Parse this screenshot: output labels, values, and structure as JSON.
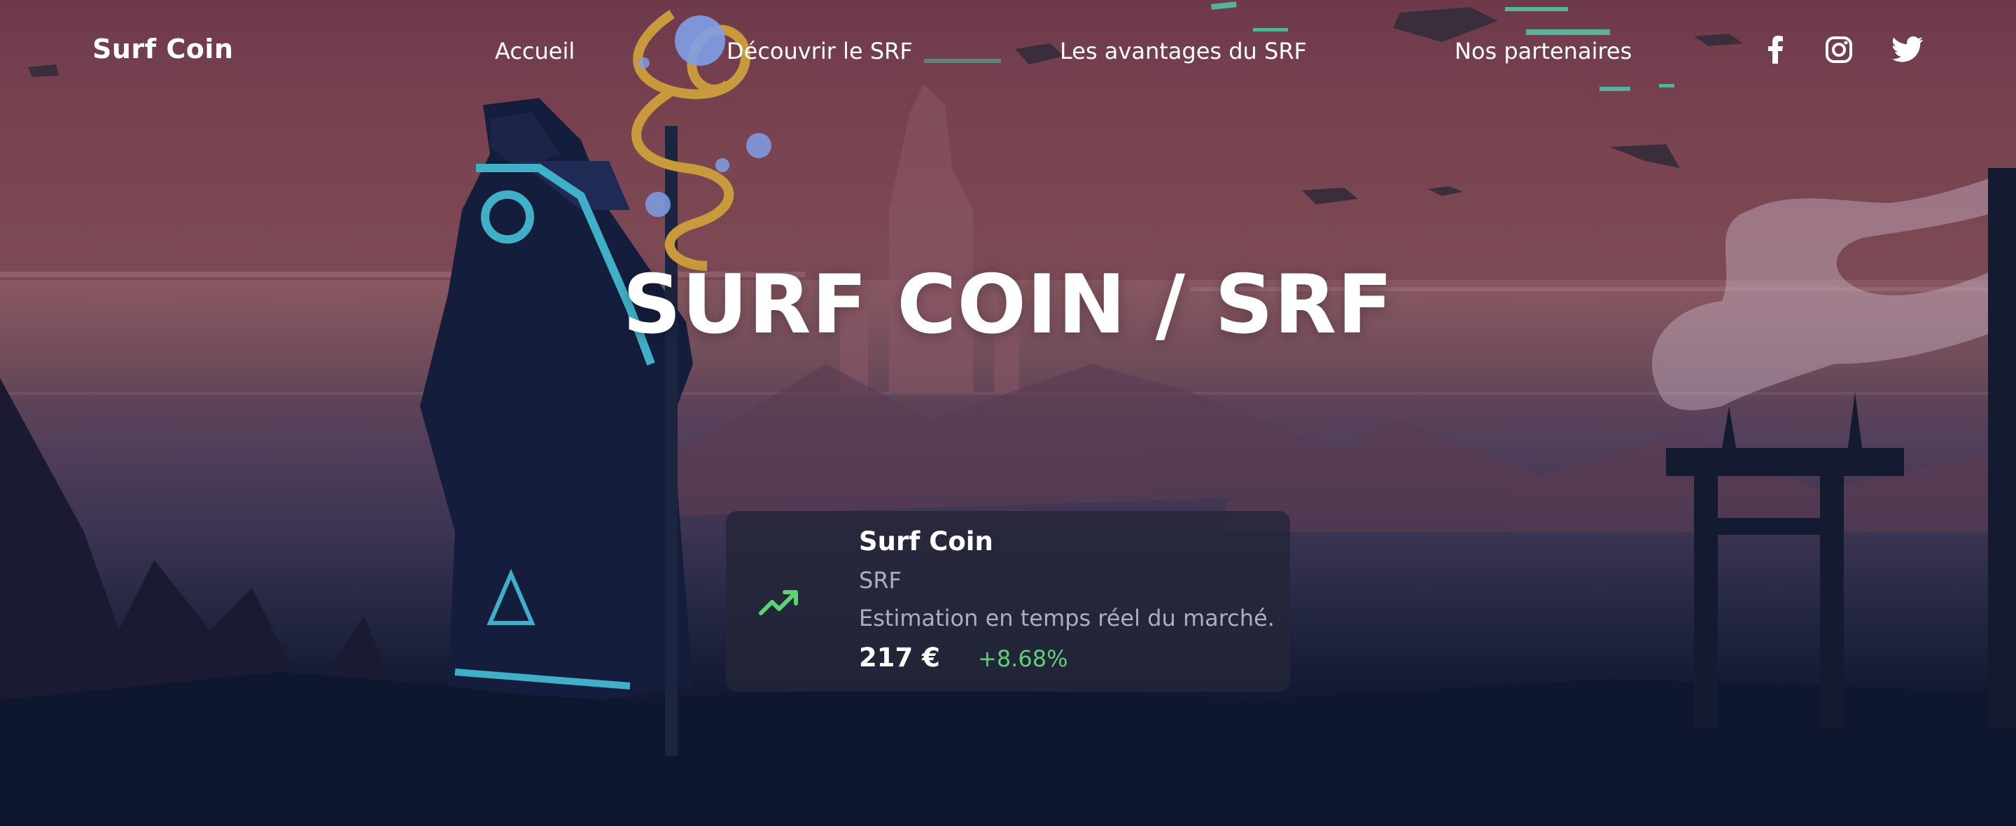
{
  "header": {
    "brand": "Surf Coin",
    "nav": [
      {
        "label": "Accueil"
      },
      {
        "label": "Découvrir le SRF"
      },
      {
        "label": "Les avantages du SRF"
      },
      {
        "label": "Nos partenaires"
      }
    ],
    "social": [
      {
        "icon": "facebook-icon"
      },
      {
        "icon": "instagram-icon"
      },
      {
        "icon": "twitter-icon"
      }
    ]
  },
  "hero": {
    "title": "SURF COIN / SRF"
  },
  "card": {
    "icon": "trending-up-icon",
    "name": "Surf Coin",
    "symbol": "SRF",
    "description": "Estimation en temps réel du marché.",
    "price": "217 €",
    "change": "+8.68%",
    "change_color": "#5fd07a"
  }
}
